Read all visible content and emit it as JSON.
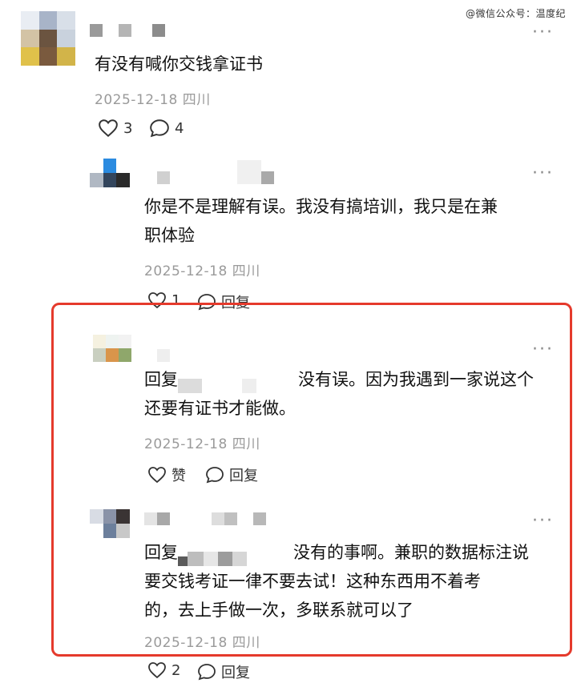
{
  "watermark": "@微信公众号：温度纪",
  "comments": [
    {
      "text": "有没有喊你交钱拿证书",
      "date": "2025-12-18 四川",
      "likes": "3",
      "replies": "4"
    },
    {
      "text_line1": "你是不是理解有误。我没有搞培训，我只是在兼",
      "text_line2": "职体验",
      "date": "2025-12-18 四川",
      "likes": "1",
      "reply_label": "回复"
    },
    {
      "reply_prefix": "回复",
      "text_line1": "没有误。因为我遇到一家说这个",
      "text_line2": "还要有证书才能做。",
      "date": "2025-12-18 四川",
      "like_label": "赞",
      "reply_label": "回复"
    },
    {
      "reply_prefix": "回复",
      "text_line1": "没有的事啊。兼职的数据标注说",
      "text_line2": "要交钱考证一律不要去试！这种东西用不着考",
      "text_line3": "的，去上手做一次，多联系就可以了",
      "date": "2025-12-18 四川",
      "likes": "2",
      "reply_label": "回复"
    }
  ],
  "icons": {
    "like": "heart-outline-icon",
    "comment": "speech-bubble-icon",
    "more": "more-dots-icon"
  },
  "colors": {
    "highlight_border": "#e53a2c",
    "meta_text": "#9a9a9a"
  }
}
